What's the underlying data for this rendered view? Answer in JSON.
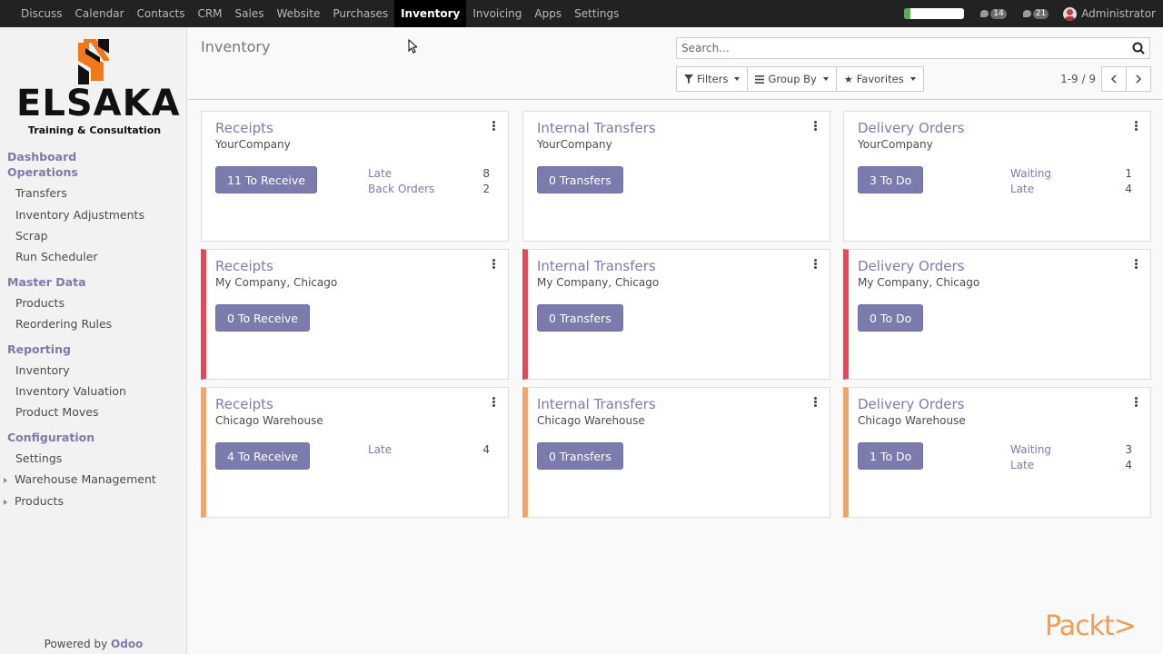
{
  "topbar": {
    "apps": [
      "Discuss",
      "Calendar",
      "Contacts",
      "CRM",
      "Sales",
      "Website",
      "Purchases",
      "Inventory",
      "Invoicing",
      "Apps",
      "Settings"
    ],
    "active_app": "Inventory",
    "progress_fraction": 0.1,
    "progress_color": "#4fb34d",
    "messages_count": "14",
    "activities_count": "21",
    "user_name": "Administrator"
  },
  "sidebar": {
    "logo_word": "ELSAKA",
    "logo_sub": "Training & Consultation",
    "logo_colors": {
      "orange": "#f07a1a",
      "dark": "#111111"
    },
    "sections": {
      "dashboard": "Dashboard",
      "operations": "Operations",
      "master_data": "Master Data",
      "reporting": "Reporting",
      "configuration": "Configuration"
    },
    "items": {
      "transfers": "Transfers",
      "inventory_adjustments": "Inventory Adjustments",
      "scrap": "Scrap",
      "run_scheduler": "Run Scheduler",
      "products": "Products",
      "reordering_rules": "Reordering Rules",
      "inventory": "Inventory",
      "inventory_valuation": "Inventory Valuation",
      "product_moves": "Product Moves",
      "settings": "Settings",
      "warehouse_management": "Warehouse Management",
      "products_config": "Products"
    },
    "powered_by": "Powered by",
    "odoo": "Odoo"
  },
  "control": {
    "title": "Inventory",
    "search_placeholder": "Search...",
    "filters": "Filters",
    "group_by": "Group By",
    "favorites": "Favorites",
    "pager": "1-9 / 9"
  },
  "cards": [
    {
      "title": "Receipts",
      "company": "YourCompany",
      "button": "11 To Receive",
      "stats": [
        {
          "label": "Late",
          "value": "8"
        },
        {
          "label": "Back Orders",
          "value": "2"
        }
      ]
    },
    {
      "title": "Internal Transfers",
      "company": "YourCompany",
      "button": "0 Transfers",
      "stats": []
    },
    {
      "title": "Delivery Orders",
      "company": "YourCompany",
      "button": "3 To Do",
      "stats": [
        {
          "label": "Waiting",
          "value": "1"
        },
        {
          "label": "Late",
          "value": "4"
        }
      ]
    },
    {
      "title": "Receipts",
      "company": "My Company, Chicago",
      "button": "0 To Receive",
      "stats": []
    },
    {
      "title": "Internal Transfers",
      "company": "My Company, Chicago",
      "button": "0 Transfers",
      "stats": []
    },
    {
      "title": "Delivery Orders",
      "company": "My Company, Chicago",
      "button": "0 To Do",
      "stats": []
    },
    {
      "title": "Receipts",
      "company": "Chicago Warehouse",
      "button": "4 To Receive",
      "stats": [
        {
          "label": "Late",
          "value": "4"
        }
      ]
    },
    {
      "title": "Internal Transfers",
      "company": "Chicago Warehouse",
      "button": "0 Transfers",
      "stats": []
    },
    {
      "title": "Delivery Orders",
      "company": "Chicago Warehouse",
      "button": "1 To Do",
      "stats": [
        {
          "label": "Waiting",
          "value": "3"
        },
        {
          "label": "Late",
          "value": "4"
        }
      ]
    }
  ],
  "colors": {
    "accent": "#7c7bad",
    "red_band": "#e04b5a",
    "orange_band": "#f0a66a"
  },
  "watermark": "Packt>"
}
